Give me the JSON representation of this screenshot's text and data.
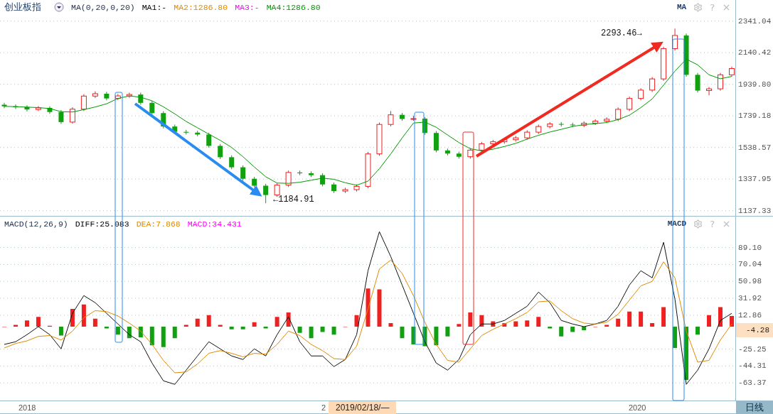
{
  "main_panel": {
    "title": "创业板指",
    "indicator": "MA(0,20,0,20)",
    "values": [
      {
        "label": "MA1:-",
        "color": "#000000"
      },
      {
        "label": "MA2:1286.80",
        "color": "#e08a00"
      },
      {
        "label": "MA3:-",
        "color": "#ff00ff"
      },
      {
        "label": "MA4:1286.80",
        "color": "#009a00"
      }
    ],
    "tag": "MA",
    "help": "?",
    "chart_data": {
      "type": "candlestick",
      "ylim": [
        1100,
        2475
      ],
      "grid": true,
      "yticks": [
        {
          "value": 2341.04,
          "label": "2341.04"
        },
        {
          "value": 2140.42,
          "label": "2140.42"
        },
        {
          "value": 1939.8,
          "label": "1939.80"
        },
        {
          "value": 1739.18,
          "label": "1739.18"
        },
        {
          "value": 1538.57,
          "label": "1538.57"
        },
        {
          "value": 1337.95,
          "label": "1337.95"
        },
        {
          "value": 1137.33,
          "label": "1137.33"
        }
      ],
      "ohlc": [
        [
          1810,
          1822,
          1788,
          1800
        ],
        [
          1800,
          1812,
          1783,
          1795
        ],
        [
          1795,
          1807,
          1768,
          1780
        ],
        [
          1780,
          1802,
          1770,
          1790
        ],
        [
          1790,
          1800,
          1752,
          1764
        ],
        [
          1764,
          1776,
          1688,
          1700
        ],
        [
          1700,
          1794,
          1690,
          1782
        ],
        [
          1782,
          1877,
          1770,
          1865
        ],
        [
          1865,
          1895,
          1853,
          1880
        ],
        [
          1880,
          1892,
          1838,
          1850
        ],
        [
          1850,
          1878,
          1840,
          1866
        ],
        [
          1866,
          1887,
          1854,
          1875
        ],
        [
          1875,
          1887,
          1810,
          1822
        ],
        [
          1822,
          1834,
          1745,
          1757
        ],
        [
          1757,
          1769,
          1660,
          1672
        ],
        [
          1672,
          1684,
          1626,
          1638
        ],
        [
          1638,
          1650,
          1621,
          1633
        ],
        [
          1633,
          1645,
          1609,
          1621
        ],
        [
          1621,
          1633,
          1537,
          1549
        ],
        [
          1549,
          1561,
          1465,
          1477
        ],
        [
          1477,
          1489,
          1401,
          1413
        ],
        [
          1413,
          1425,
          1328,
          1340
        ],
        [
          1340,
          1352,
          1284,
          1296
        ],
        [
          1296,
          1308,
          1185,
          1237
        ],
        [
          1237,
          1312,
          1225,
          1300
        ],
        [
          1300,
          1392,
          1288,
          1380
        ],
        [
          1380,
          1392,
          1363,
          1375
        ],
        [
          1375,
          1387,
          1351,
          1363
        ],
        [
          1363,
          1375,
          1292,
          1304
        ],
        [
          1304,
          1316,
          1250,
          1262
        ],
        [
          1262,
          1283,
          1250,
          1271
        ],
        [
          1271,
          1304,
          1259,
          1292
        ],
        [
          1292,
          1510,
          1280,
          1498
        ],
        [
          1498,
          1697,
          1486,
          1685
        ],
        [
          1685,
          1770,
          1673,
          1746
        ],
        [
          1746,
          1758,
          1708,
          1720
        ],
        [
          1720,
          1740,
          1708,
          1722
        ],
        [
          1722,
          1732,
          1619,
          1631
        ],
        [
          1631,
          1643,
          1508,
          1520
        ],
        [
          1520,
          1532,
          1488,
          1500
        ],
        [
          1500,
          1512,
          1468,
          1480
        ],
        [
          1480,
          1534,
          1468,
          1522
        ],
        [
          1522,
          1574,
          1510,
          1562
        ],
        [
          1562,
          1587,
          1550,
          1575
        ],
        [
          1575,
          1600,
          1563,
          1588
        ],
        [
          1588,
          1612,
          1576,
          1600
        ],
        [
          1600,
          1648,
          1588,
          1636
        ],
        [
          1636,
          1684,
          1624,
          1672
        ],
        [
          1672,
          1700,
          1660,
          1688
        ],
        [
          1688,
          1700,
          1672,
          1684
        ],
        [
          1684,
          1696,
          1668,
          1680
        ],
        [
          1680,
          1705,
          1668,
          1693
        ],
        [
          1693,
          1718,
          1681,
          1706
        ],
        [
          1706,
          1730,
          1694,
          1718
        ],
        [
          1718,
          1793,
          1706,
          1781
        ],
        [
          1781,
          1862,
          1769,
          1850
        ],
        [
          1850,
          1915,
          1838,
          1903
        ],
        [
          1903,
          1986,
          1891,
          1974
        ],
        [
          1974,
          2178,
          1962,
          2166
        ],
        [
          2166,
          2293,
          2154,
          2250
        ],
        [
          2250,
          2262,
          1988,
          2000
        ],
        [
          2000,
          2012,
          1888,
          1900
        ],
        [
          1900,
          1923,
          1870,
          1911
        ],
        [
          1911,
          2012,
          1899,
          2000
        ],
        [
          2000,
          2052,
          1988,
          2040
        ]
      ],
      "series": [
        {
          "type": "line",
          "color": "#009a00",
          "values": [
            1800,
            1798,
            1795,
            1792,
            1786,
            1766,
            1764,
            1779,
            1796,
            1816,
            1850,
            1866,
            1858,
            1835,
            1797,
            1752,
            1704,
            1664,
            1623,
            1584,
            1539,
            1480,
            1415,
            1353,
            1313,
            1311,
            1318,
            1331,
            1344,
            1337,
            1315,
            1299,
            1325,
            1404,
            1498,
            1599,
            1694,
            1700,
            1667,
            1618,
            1570,
            1531,
            1517,
            1528,
            1545,
            1565,
            1592,
            1616,
            1637,
            1654,
            1672,
            1684,
            1690,
            1697,
            1716,
            1744,
            1792,
            1847,
            1935,
            2023,
            2100,
            2063,
            2000,
            1975,
            1990
          ]
        }
      ]
    },
    "annotations": [
      {
        "text": "2293.46→"
      },
      {
        "text": "←1184.91"
      }
    ]
  },
  "macd_panel": {
    "indicator": "MACD(12,26,9)",
    "values": [
      {
        "label": "DIFF:25.083",
        "color": "#000000"
      },
      {
        "label": "DEA:7.868",
        "color": "#e08a00"
      },
      {
        "label": "MACD:34.431",
        "color": "#ff00ff"
      }
    ],
    "tag": "MACD",
    "help": "?",
    "chart_data": {
      "type": "line",
      "ylim": [
        -84,
        124
      ],
      "grid": true,
      "yticks": [
        {
          "value": 89.1,
          "label": "89.10"
        },
        {
          "value": 70.04,
          "label": "70.04"
        },
        {
          "value": 50.98,
          "label": "50.98"
        },
        {
          "value": 31.92,
          "label": "31.92"
        },
        {
          "value": 12.86,
          "label": "12.86"
        },
        {
          "value": -25.25,
          "label": "-25.25"
        },
        {
          "value": -44.31,
          "label": "-44.31"
        },
        {
          "value": -63.37,
          "label": "-63.37"
        }
      ],
      "series": [
        {
          "type": "bar",
          "color": "#f02020",
          "values": [
            0,
            2,
            7,
            11,
            1,
            null,
            20,
            25,
            9,
            null,
            null,
            null,
            null,
            null,
            null,
            null,
            2,
            9,
            13,
            2,
            null,
            null,
            5,
            null,
            11,
            16,
            null,
            null,
            null,
            null,
            0,
            13,
            43,
            42,
            4,
            null,
            null,
            null,
            null,
            null,
            3,
            16,
            13,
            6,
            4,
            6,
            7,
            11,
            null,
            null,
            null,
            null,
            0,
            2,
            9,
            17,
            17,
            4,
            22,
            null,
            null,
            null,
            13,
            22,
            12
          ]
        },
        {
          "type": "bar",
          "color": "#10a010",
          "values": [
            null,
            null,
            null,
            null,
            null,
            -10,
            null,
            null,
            null,
            -2,
            -9,
            -13,
            -12,
            -21,
            -23,
            -13,
            null,
            null,
            null,
            null,
            -3,
            -3,
            null,
            -2,
            null,
            null,
            -7,
            -13,
            -6,
            -9,
            null,
            null,
            null,
            null,
            null,
            -13,
            -20,
            -22,
            -21,
            -11,
            null,
            null,
            null,
            null,
            null,
            null,
            null,
            null,
            -2,
            -11,
            -6,
            -4,
            null,
            null,
            null,
            null,
            null,
            null,
            null,
            -24,
            -60,
            -9,
            null,
            null,
            null
          ]
        },
        {
          "type": "line",
          "color": "#111111",
          "values": [
            -20,
            -17,
            -9,
            0,
            -9,
            -25,
            15,
            35,
            27,
            15,
            3,
            -9,
            -17,
            -41,
            -61,
            -65,
            -49,
            -33,
            -17,
            -25,
            -33,
            -37,
            -25,
            -33,
            -9,
            11,
            -17,
            -33,
            -33,
            -45,
            -37,
            -9,
            63,
            107,
            79,
            47,
            15,
            -17,
            -41,
            -49,
            -37,
            -9,
            3,
            3,
            7,
            15,
            23,
            39,
            27,
            7,
            3,
            0,
            3,
            7,
            23,
            47,
            63,
            55,
            95,
            31,
            -65,
            -49,
            -25,
            7,
            15
          ]
        },
        {
          "type": "line",
          "color": "#e08a00",
          "values": [
            -24,
            -19,
            -16,
            -11,
            -10,
            -15,
            -5,
            10,
            18,
            17,
            12,
            4,
            -5,
            -20,
            -38,
            -52,
            -51,
            -42,
            -30,
            -27,
            -30,
            -34,
            -30,
            -31,
            -20,
            -5,
            -10,
            -20,
            -27,
            -36,
            -37,
            -22,
            20,
            65,
            75,
            60,
            35,
            5,
            -20,
            -38,
            -40,
            -25,
            -10,
            -3,
            3,
            9,
            16,
            28,
            29,
            18,
            9,
            4,
            3,
            5,
            14,
            30,
            46,
            51,
            73,
            55,
            -5,
            -40,
            -38,
            -15,
            3
          ]
        }
      ]
    },
    "current_value": "-4.28"
  },
  "x_axis": {
    "ticks": [
      "2018",
      "2",
      "2020"
    ],
    "cursor_label": "2019/02/18/—"
  },
  "period_tab": "日线"
}
